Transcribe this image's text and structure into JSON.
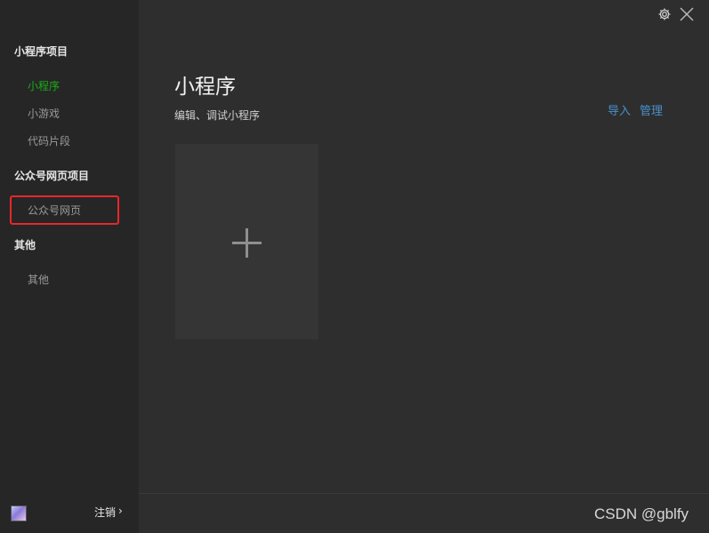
{
  "sidebar": {
    "miniprogram_section": "小程序项目",
    "miniprogram_items": [
      "小程序",
      "小游戏",
      "代码片段"
    ],
    "official_section": "公众号网页项目",
    "official_items": [
      "公众号网页"
    ],
    "other_section": "其他",
    "other_items": [
      "其他"
    ],
    "logout_label": "注销",
    "logout_chevron": "›"
  },
  "header": {
    "settings_icon": "gear-icon",
    "close_icon": "close-icon"
  },
  "main": {
    "title": "小程序",
    "subtitle": "编辑、调试小程序",
    "import_label": "导入",
    "manage_label": "管理",
    "add_icon": "plus-icon"
  },
  "watermark": "CSDN @gblfy",
  "colors": {
    "accent_green": "#1aad19",
    "link_blue": "#4a90c9",
    "highlight_red": "#e8262c"
  }
}
